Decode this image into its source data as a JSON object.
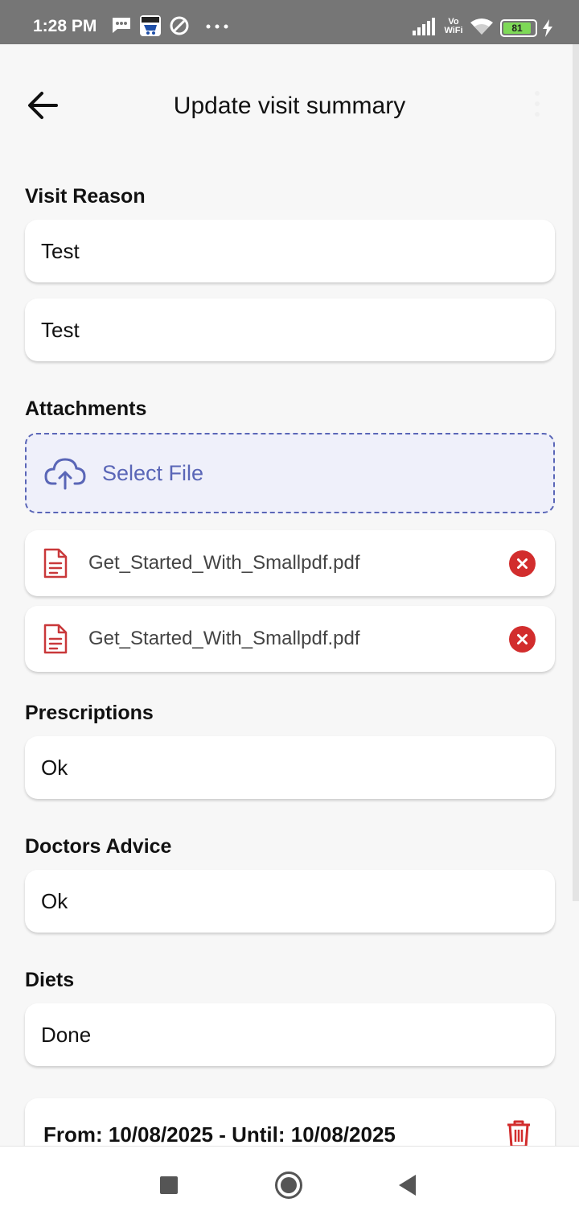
{
  "status_bar": {
    "time": "1:28 PM",
    "battery": "81",
    "icons": [
      "message-icon",
      "amazon-icon",
      "at-icon",
      "more-dots-icon",
      "signal-icon",
      "vowifi-icon",
      "wifi-icon",
      "battery-icon",
      "charging-icon"
    ],
    "vowifi_top": "Vo",
    "vowifi_bottom": "WiFi"
  },
  "header": {
    "title": "Update visit summary",
    "back_icon": "arrow-left-icon",
    "menu_icon": "more-vertical-icon"
  },
  "visit_reason": {
    "label": "Visit Reason",
    "value": "Test",
    "detail_value": "Test"
  },
  "attachments": {
    "label": "Attachments",
    "select_label": "Select File",
    "files": [
      {
        "name": "Get_Started_With_Smallpdf.pdf"
      },
      {
        "name": "Get_Started_With_Smallpdf.pdf"
      }
    ]
  },
  "prescriptions": {
    "label": "Prescriptions",
    "value": "Ok"
  },
  "doctors_advice": {
    "label": "Doctors Advice",
    "value": "Ok"
  },
  "diets": {
    "label": "Diets",
    "value": "Done",
    "range": "From: 10/08/2025 - Until: 10/08/2025"
  },
  "colors": {
    "accent": "#5a66b7",
    "danger": "#d22d2d",
    "status_bar": "#767676"
  }
}
